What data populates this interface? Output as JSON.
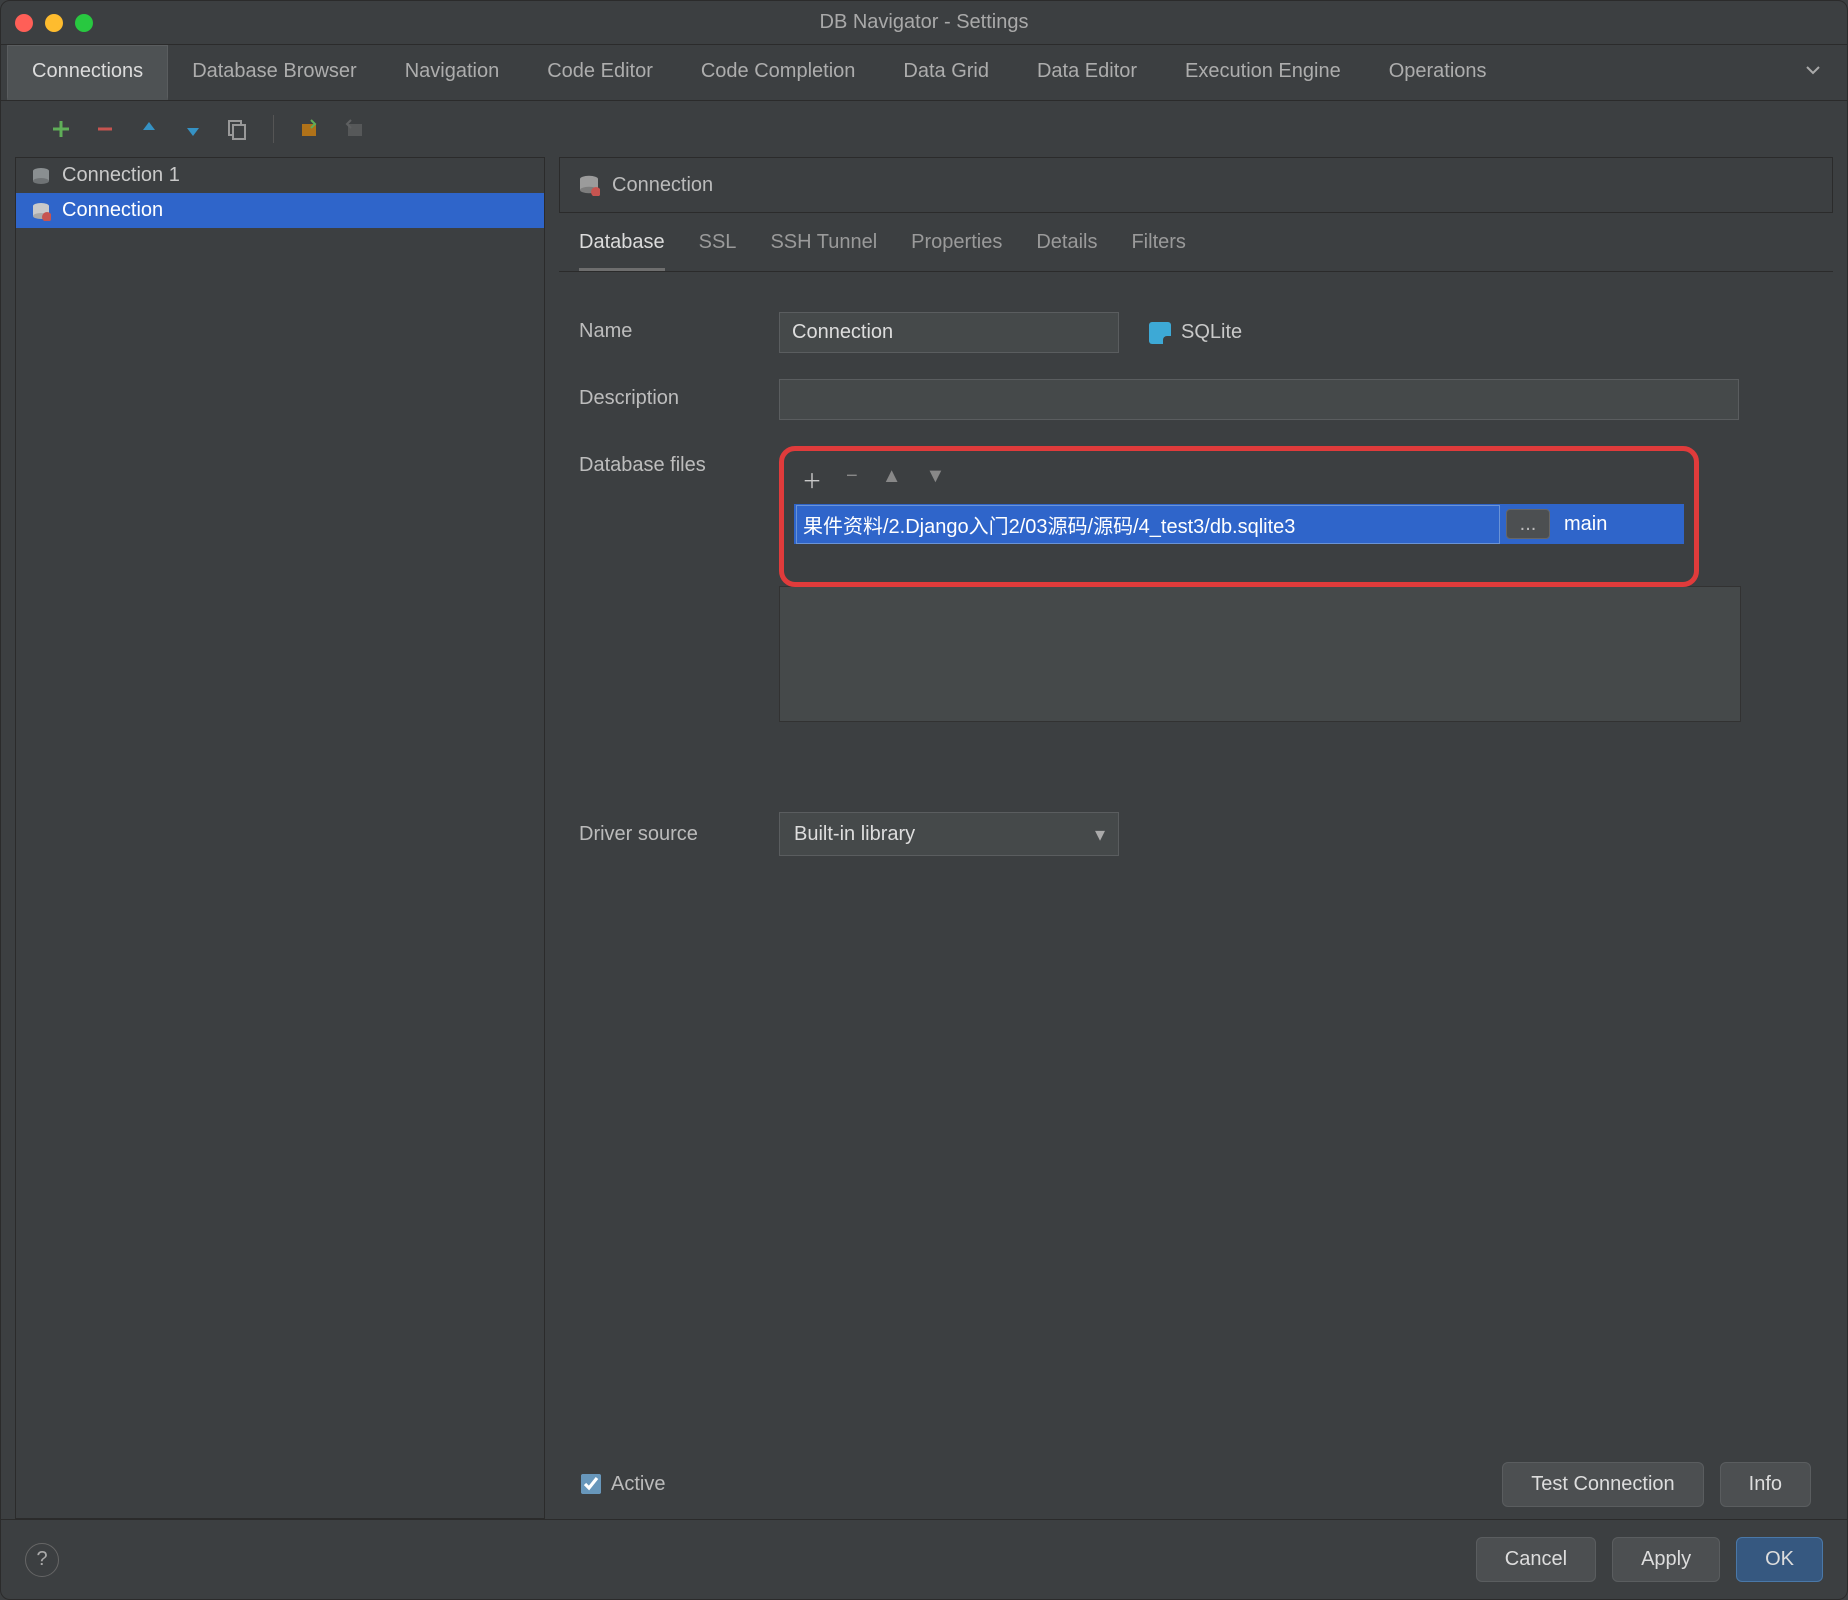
{
  "window": {
    "title": "DB Navigator - Settings"
  },
  "top_tabs": {
    "items": [
      "Connections",
      "Database Browser",
      "Navigation",
      "Code Editor",
      "Code Completion",
      "Data Grid",
      "Data Editor",
      "Execution Engine",
      "Operations"
    ],
    "active_index": 0
  },
  "sidebar": {
    "items": [
      {
        "label": "Connection 1",
        "selected": false
      },
      {
        "label": "Connection",
        "selected": true
      }
    ]
  },
  "panel": {
    "title": "Connection"
  },
  "sub_tabs": {
    "items": [
      "Database",
      "SSL",
      "SSH Tunnel",
      "Properties",
      "Details",
      "Filters"
    ],
    "active_index": 0
  },
  "form": {
    "name_label": "Name",
    "name_value": "Connection",
    "db_type": "SQLite",
    "description_label": "Description",
    "description_value": "",
    "db_files_label": "Database files",
    "db_file_path": "果件资料/2.Django入门2/03源码/源码/4_test3/db.sqlite3",
    "db_file_browse": "...",
    "db_file_schema": "main",
    "driver_label": "Driver source",
    "driver_value": "Built-in library"
  },
  "bottom": {
    "active_label": "Active",
    "active_checked": true,
    "test_label": "Test Connection",
    "info_label": "Info"
  },
  "footer": {
    "help": "?",
    "cancel": "Cancel",
    "apply": "Apply",
    "ok": "OK"
  },
  "colors": {
    "highlight_border": "#e03b3b",
    "selection": "#2f65ca"
  }
}
